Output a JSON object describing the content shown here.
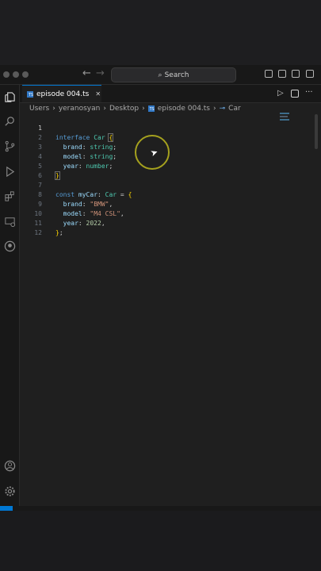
{
  "titlebar": {
    "search_placeholder": "Search"
  },
  "tab": {
    "name": "episode 004.ts",
    "close": "✕"
  },
  "breadcrumb": [
    "Users",
    "yeranosyan",
    "Desktop",
    "episode 004.ts",
    "Car"
  ],
  "editor": {
    "lines": [
      "1",
      "2",
      "3",
      "4",
      "5",
      "6",
      "7",
      "8",
      "9",
      "10",
      "11",
      "12"
    ]
  },
  "code": {
    "l1_kw": "interface",
    "l1_ty": "Car",
    "l1_br": "{",
    "l2_pr": "brand",
    "l2_ty": "string",
    "l3_pr": "model",
    "l3_ty": "string",
    "l4_pr": "year",
    "l4_ty": "number",
    "l5_br": "}",
    "l7_kw": "const",
    "l7_pr": "myCar",
    "l7_ty": "Car",
    "l8_pr": "brand",
    "l8_st": "\"BMW\"",
    "l9_pr": "model",
    "l9_st": "\"M4 CSL\"",
    "l10_pr": "year",
    "l10_nu": "2022"
  },
  "icons": [
    "explorer-icon",
    "search-icon",
    "source-control-icon",
    "run-debug-icon",
    "extensions-icon",
    "remote-icon",
    "github-icon",
    "account-icon",
    "settings-gear-icon"
  ]
}
